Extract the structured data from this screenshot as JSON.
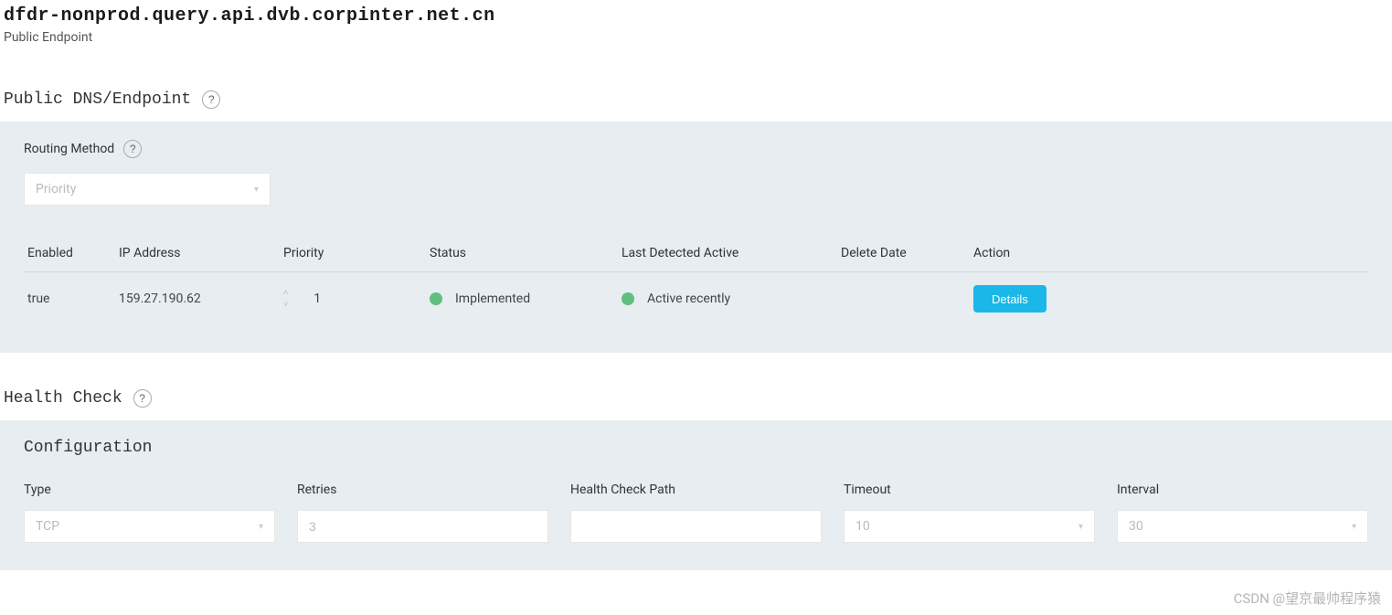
{
  "header": {
    "title": "dfdr-nonprod.query.api.dvb.corpinter.net.cn",
    "subtitle": "Public Endpoint"
  },
  "dnsSection": {
    "heading": "Public DNS/Endpoint",
    "routingLabel": "Routing Method",
    "routingValue": "Priority",
    "table": {
      "headers": {
        "enabled": "Enabled",
        "ip": "IP Address",
        "priority": "Priority",
        "status": "Status",
        "lastActive": "Last Detected Active",
        "deleteDate": "Delete Date",
        "action": "Action"
      },
      "row": {
        "enabled": "true",
        "ip": "159.27.190.62",
        "priority": "1",
        "statusText": "Implemented",
        "lastActiveText": "Active recently",
        "deleteDate": "",
        "actionLabel": "Details"
      }
    }
  },
  "healthSection": {
    "heading": "Health Check",
    "configHeading": "Configuration",
    "fields": {
      "type": {
        "label": "Type",
        "value": "TCP"
      },
      "retries": {
        "label": "Retries",
        "value": "3"
      },
      "path": {
        "label": "Health Check Path",
        "value": ""
      },
      "timeout": {
        "label": "Timeout",
        "value": "10"
      },
      "interval": {
        "label": "Interval",
        "value": "30"
      }
    }
  },
  "watermark": "CSDN @望京最帅程序猿"
}
